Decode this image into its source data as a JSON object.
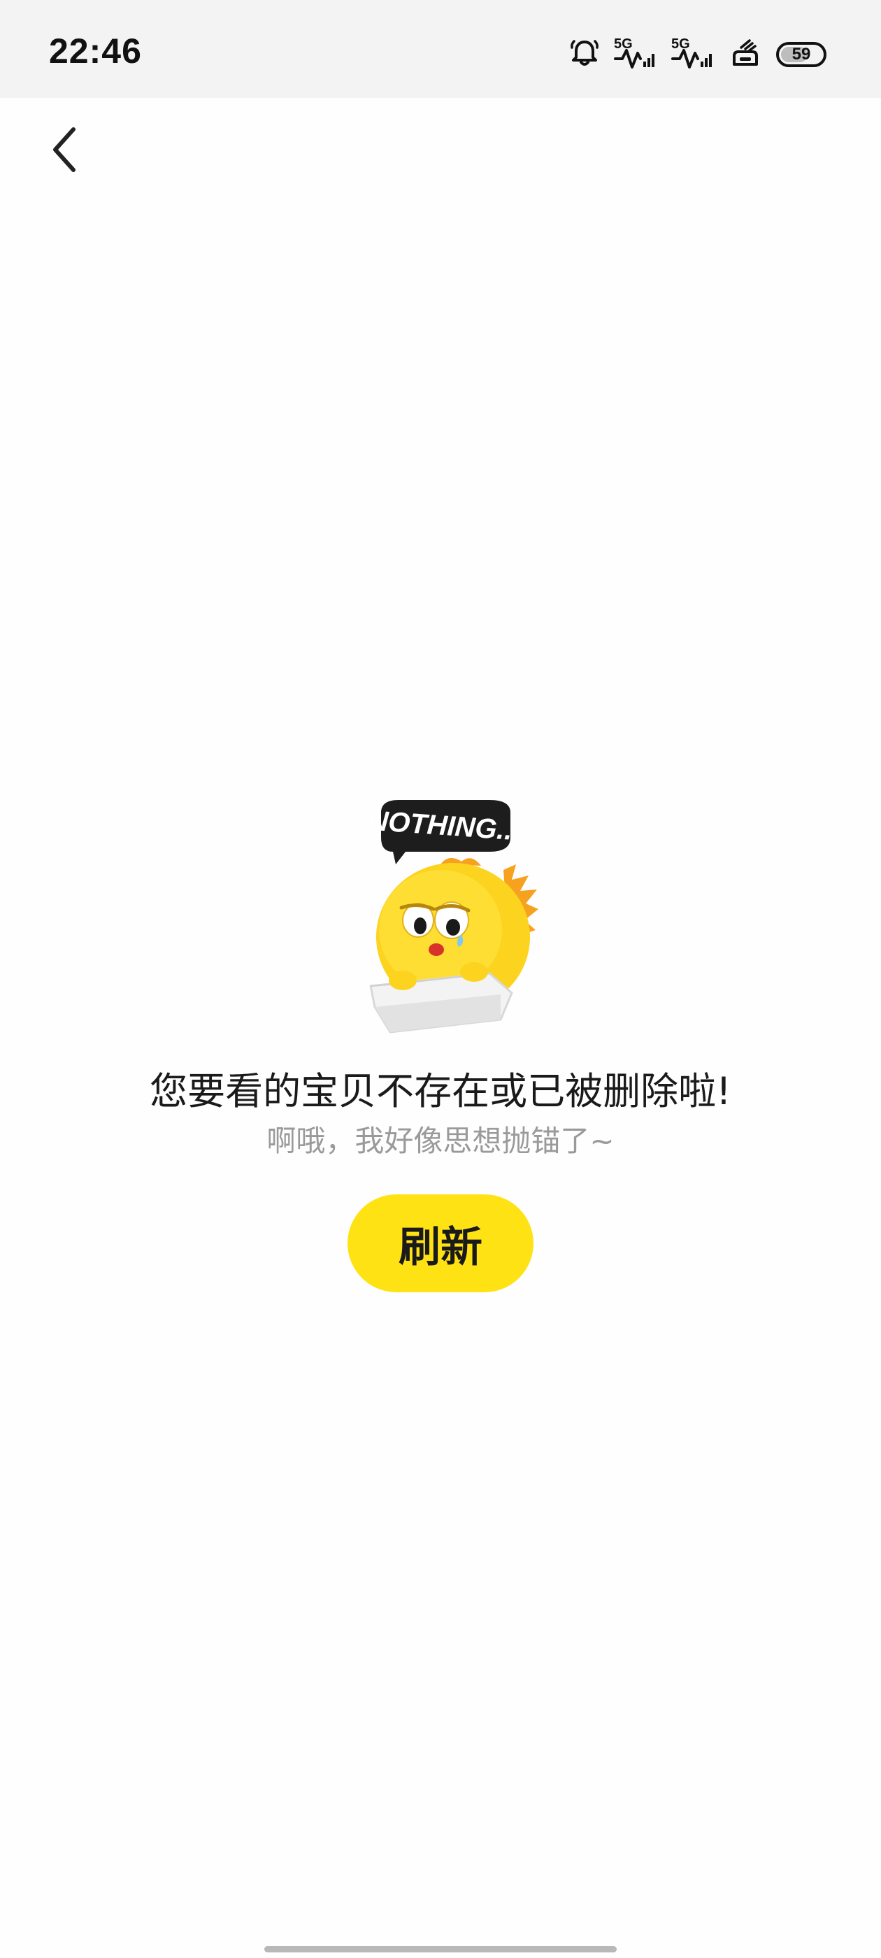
{
  "status_bar": {
    "time": "22:46",
    "network_1": "5G",
    "network_2": "5G",
    "battery_level": "59",
    "icons": [
      "bell-icon",
      "signal-5g-icon",
      "signal-5g-icon",
      "wifi-hotspot-icon",
      "battery-icon"
    ]
  },
  "nav": {
    "back_icon": "chevron-left-icon"
  },
  "empty_state": {
    "bubble_text": "NOTHING...",
    "title": "您要看的宝贝不存在或已被删除啦!",
    "subtitle": "啊哦，我好像思想抛锚了~",
    "refresh_label": "刷新"
  },
  "colors": {
    "accent": "#ffe214",
    "background": "#fefefe",
    "status_bar_bg": "#f3f3f3",
    "title_text": "#1a1a1a",
    "subtitle_text": "#9a9a9a"
  }
}
